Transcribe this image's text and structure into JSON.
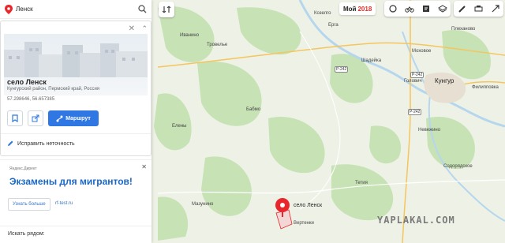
{
  "search": {
    "query": "Ленск"
  },
  "card": {
    "title": "село Ленск",
    "subtitle": "Кунгурский район, Пермский край, Россия",
    "coords": "57.298646, 56.657385",
    "route_label": "Маршрут",
    "fix_label": "Исправить неточность"
  },
  "ad": {
    "source": "Яндекс.Директ",
    "headline": "Экзамены для мигрантов!",
    "more_label": "Узнать больше",
    "domain": "rf-test.ru"
  },
  "bottom": {
    "label": "Искать рядом:"
  },
  "toolbar": {
    "moy_label": "Мой",
    "moy_year": "2018"
  },
  "map": {
    "marker_label": "село Ленск",
    "roads": [
      "Р-242",
      "Р-242",
      "Р-242"
    ],
    "places": [
      "Козелго",
      "Ерга",
      "Иванино",
      "Тровелье",
      "Плеханово",
      "Шадейка",
      "Моховое",
      "Кунгур",
      "Голович",
      "Филипповка",
      "Бабмо",
      "Елены",
      "Невежино",
      "Содорядское",
      "Тетия",
      "Мазунино",
      "Вертенки"
    ],
    "watermark": "YAPLAKAL.COM"
  },
  "colors": {
    "accent": "#2f78e3",
    "marker": "#e9262b",
    "water": "#b6d6ee",
    "forest": "#c7e2b5",
    "field": "#eef2e6"
  }
}
